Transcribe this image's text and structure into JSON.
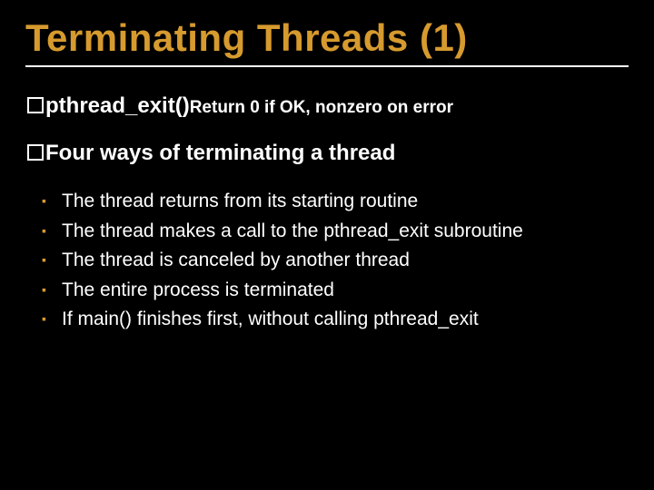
{
  "title": "Terminating Threads (1)",
  "line1": {
    "fn": "pthread_exit()",
    "ret": "Return 0 if OK, nonzero on error"
  },
  "line2": {
    "text": "Four ways of terminating a thread"
  },
  "bullets": [
    "The thread returns from its starting routine",
    "The thread makes a call to the pthread_exit subroutine",
    "The thread is canceled by another thread",
    "The entire process is terminated",
    "If main() finishes first, without calling pthread_exit"
  ]
}
